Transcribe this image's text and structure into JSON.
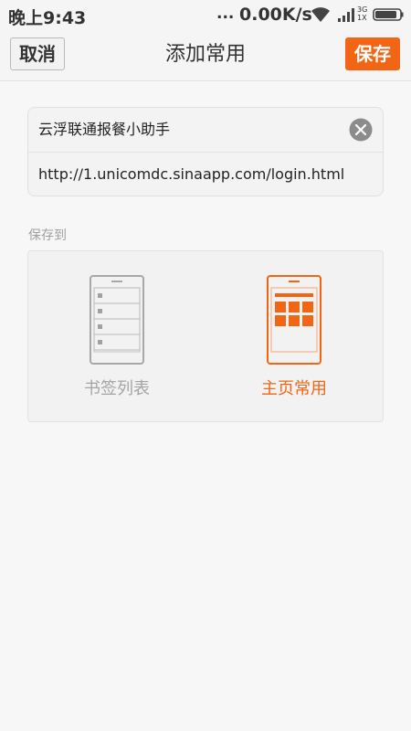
{
  "status_bar": {
    "time": "晚上9:43",
    "dots": "...",
    "net_speed": "0.00K/s",
    "network_top": "3G",
    "network_bottom": "1X"
  },
  "header": {
    "cancel_label": "取消",
    "title": "添加常用",
    "save_label": "保存"
  },
  "form": {
    "title_value": "云浮联通报餐小助手",
    "url_value": "http://1.unicomdc.sinaapp.com/login.html"
  },
  "save_to": {
    "label": "保存到",
    "options": [
      {
        "label": "书签列表",
        "icon": "bookmark-list-icon",
        "selected": false
      },
      {
        "label": "主页常用",
        "icon": "homepage-grid-icon",
        "selected": true
      }
    ]
  },
  "colors": {
    "accent": "#f26514",
    "inactive": "#a4a4a4",
    "background": "#f7f7f7"
  }
}
